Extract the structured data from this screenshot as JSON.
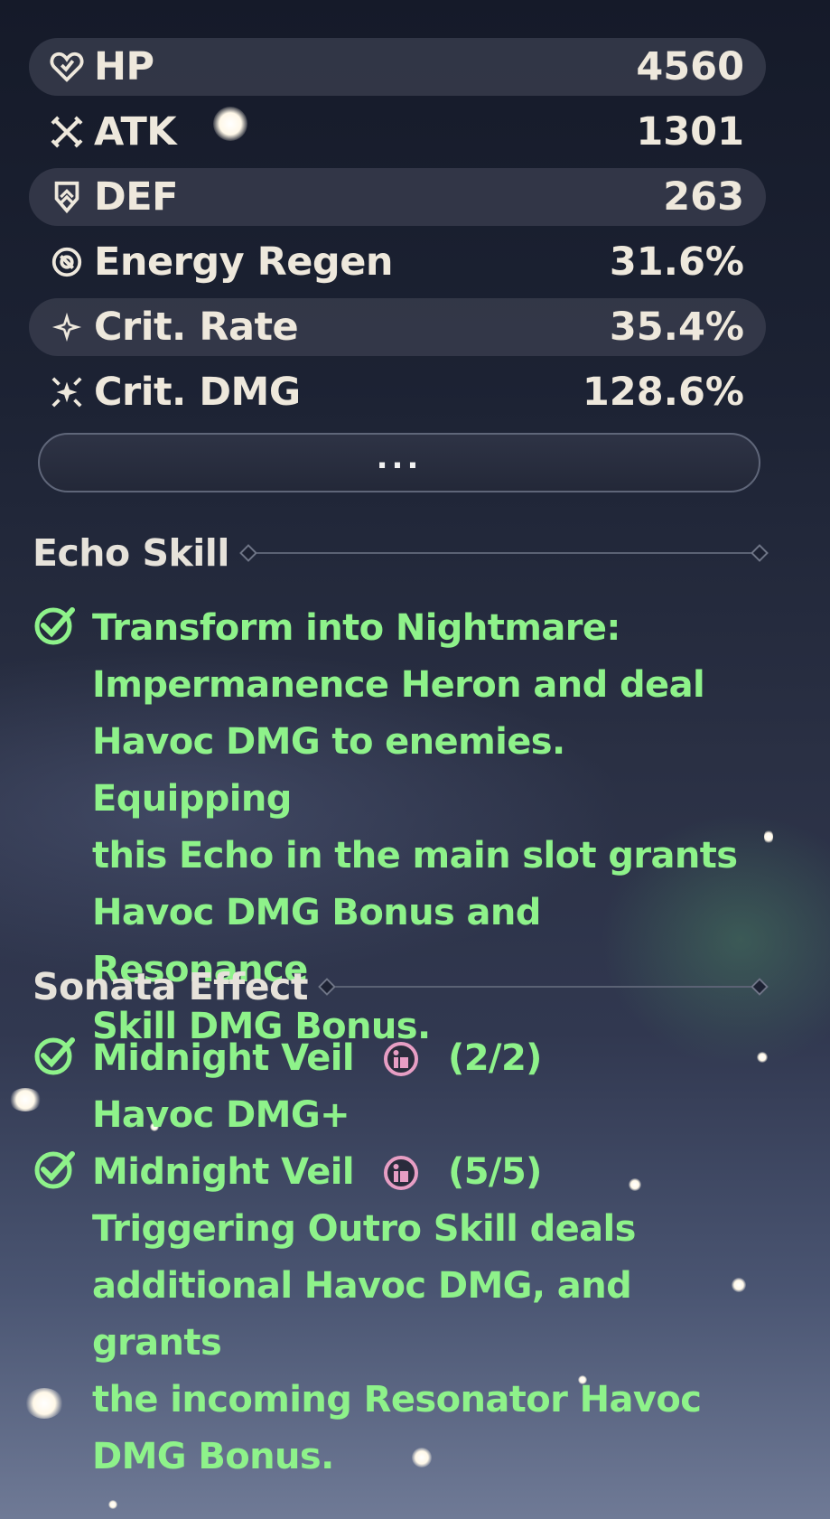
{
  "stats": [
    {
      "label": "HP",
      "value": "4560",
      "icon": "heart-icon"
    },
    {
      "label": "ATK",
      "value": "1301",
      "icon": "crossed-swords-icon"
    },
    {
      "label": "DEF",
      "value": "263",
      "icon": "shield-icon"
    },
    {
      "label": "Energy Regen",
      "value": "31.6%",
      "icon": "energy-regen-icon"
    },
    {
      "label": "Crit. Rate",
      "value": "35.4%",
      "icon": "crit-rate-icon"
    },
    {
      "label": "Crit. DMG",
      "value": "128.6%",
      "icon": "crit-dmg-icon"
    }
  ],
  "more_button": {
    "label": "..."
  },
  "echo_skill": {
    "title": "Echo Skill",
    "lines": [
      "Transform into Nightmare:",
      "Impermanence Heron and deal",
      "Havoc DMG to enemies. Equipping",
      "this Echo in the main slot grants",
      "Havoc DMG Bonus and Resonance",
      "Skill DMG Bonus."
    ]
  },
  "sonata_effect": {
    "title": "Sonata Effect",
    "items": [
      {
        "name": "Midnight Veil",
        "count": "(2/2)",
        "lines": [
          "Havoc DMG+"
        ]
      },
      {
        "name": "Midnight Veil",
        "count": "(5/5)",
        "lines": [
          "Triggering Outro Skill deals",
          "additional Havoc DMG, and grants",
          "the incoming Resonator Havoc",
          "DMG Bonus."
        ]
      }
    ]
  },
  "colors": {
    "stat_text": "#eee8dc",
    "effect_text": "#8ef28a",
    "badge": "#e79ec4",
    "row_shade": "#3a3e4e"
  }
}
